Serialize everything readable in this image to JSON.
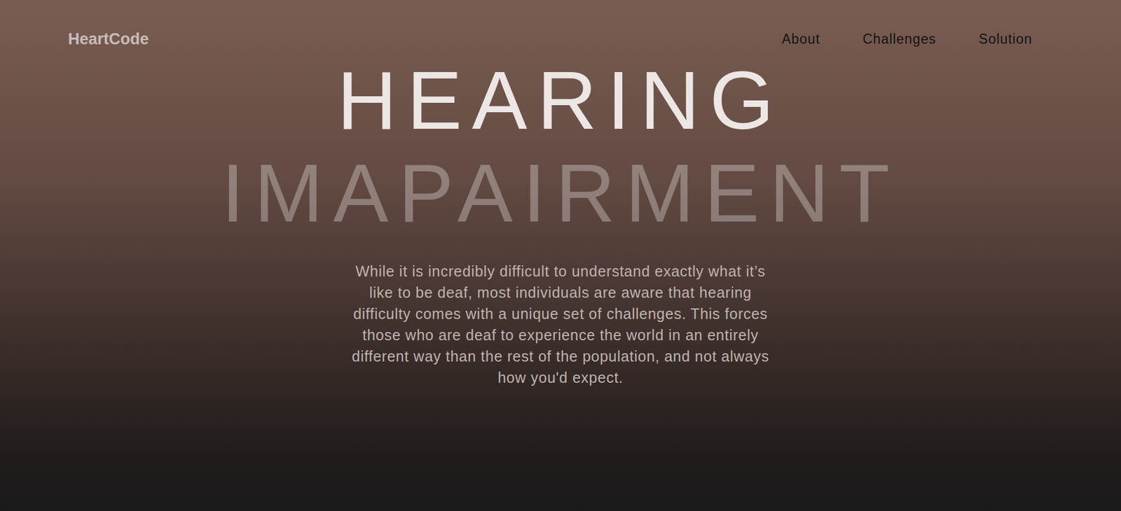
{
  "brand": "HeartCode",
  "nav": [
    {
      "label": "About"
    },
    {
      "label": "Challenges"
    },
    {
      "label": "Solution"
    }
  ],
  "hero": {
    "title_lines": [
      "HEARING",
      "IMAPAIRMENT"
    ],
    "description": "While it is incredibly difficult to understand exactly what it’s like to be deaf, most individuals are aware that hearing difficulty comes with a unique set of challenges. This forces those who are deaf to experience the world in an entirely different way than the rest of the population, and not always how you'd expect."
  }
}
